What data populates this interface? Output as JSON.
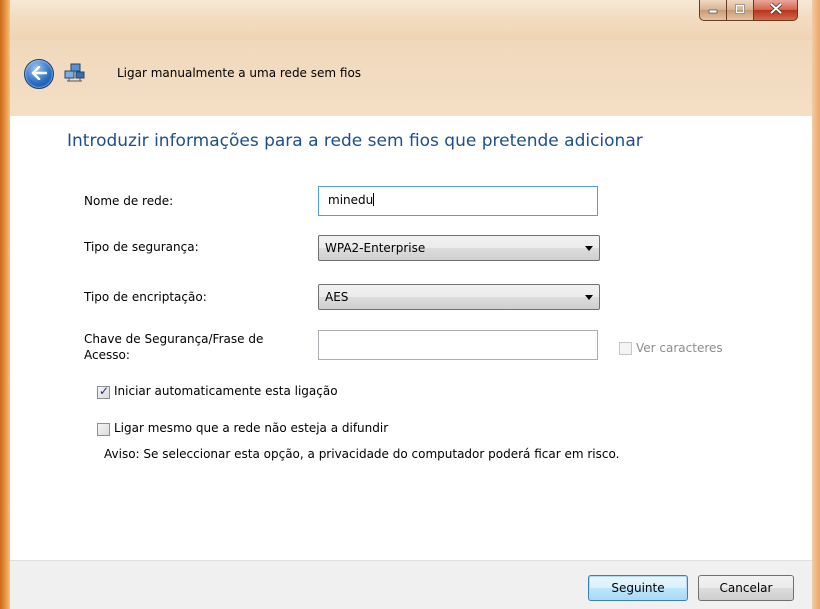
{
  "window": {
    "caption_buttons": {
      "minimize_icon": "minimize-icon",
      "maximize_icon": "maximize-icon",
      "close_icon": "close-icon"
    }
  },
  "nav": {
    "back_icon": "back-arrow-icon",
    "app_icon": "wireless-network-icon",
    "title": "Ligar manualmente a uma rede sem fios"
  },
  "main": {
    "heading": "Introduzir informações para a rede sem fios que pretende adicionar",
    "fields": {
      "network_name": {
        "label": "Nome de rede:",
        "value": "minedu"
      },
      "security_type": {
        "label": "Tipo de segurança:",
        "value": "WPA2-Enterprise"
      },
      "encryption_type": {
        "label": "Tipo de encriptação:",
        "value": "AES"
      },
      "security_key": {
        "label_line1": "Chave de Segurança/Frase de",
        "label_line2": "Acesso:",
        "value": ""
      }
    },
    "show_characters": {
      "label": "Ver caracteres",
      "checked": false,
      "enabled": false
    },
    "auto_start": {
      "label": "Iniciar automaticamente esta ligação",
      "checked": true
    },
    "connect_not_broadcasting": {
      "label": "Ligar mesmo que a rede não esteja a difundir",
      "checked": false
    },
    "warning": "Aviso: Se seleccionar esta opção, a privacidade do computador poderá ficar em risco."
  },
  "footer": {
    "next_label": "Seguinte",
    "cancel_label": "Cancelar"
  },
  "colors": {
    "heading": "#1e4e8c",
    "border_accent": "#e99442"
  }
}
